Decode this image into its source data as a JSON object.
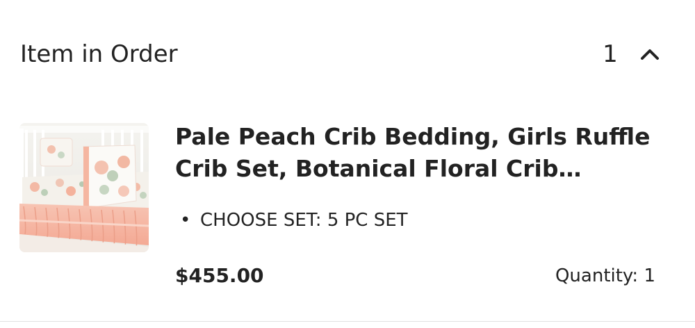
{
  "section": {
    "title": "Item in Order",
    "count": "1",
    "toggle_icon": "chevron-up-icon"
  },
  "item": {
    "title": "Pale Peach Crib Bedding, Girls Ruffle Crib Set, Botanical Floral Crib Bedding",
    "variation_bullet": "•",
    "variation": "CHOOSE SET: 5 PC SET",
    "price": "$455.00",
    "quantity": "Quantity: 1",
    "colors": {
      "peach": "#f6b9a6",
      "floral_white": "#f7f4ef",
      "crib_white": "#f3f2ee"
    }
  }
}
